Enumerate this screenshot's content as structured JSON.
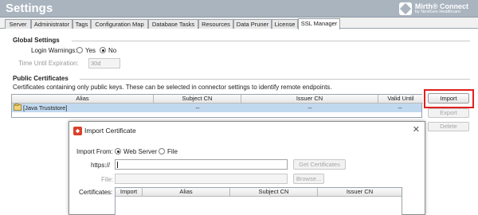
{
  "header": {
    "title": "Settings",
    "logo_name": "Mirth® Connect",
    "logo_sub": "by NextGen Healthcare"
  },
  "tabs": [
    {
      "label": "Server"
    },
    {
      "label": "Administrator"
    },
    {
      "label": "Tags"
    },
    {
      "label": "Configuration Map"
    },
    {
      "label": "Database Tasks"
    },
    {
      "label": "Resources"
    },
    {
      "label": "Data Pruner"
    },
    {
      "label": "License"
    },
    {
      "label": "SSL Manager",
      "active": true
    }
  ],
  "global_settings": {
    "title": "Global Settings",
    "login_warnings_label": "Login Warnings:",
    "yes_label": "Yes",
    "no_label": "No",
    "selected": "No",
    "time_until_expiration_label": "Time Until Expiration:",
    "time_until_expiration_value": "30d"
  },
  "public_certificates": {
    "title": "Public Certificates",
    "description": "Certificates containing only public keys. These can be selected in connector settings to identify remote endpoints.",
    "columns": [
      "Alias",
      "Subject CN",
      "Issuer CN",
      "Valid Until"
    ],
    "rows": [
      {
        "alias": "[Java Truststore]",
        "subject_cn": "--",
        "issuer_cn": "--",
        "valid_until": "--"
      }
    ],
    "import_button": "Import",
    "export_button": "Export",
    "delete_button": "Delete"
  },
  "dialog": {
    "title": "Import Certificate",
    "import_from_label": "Import From:",
    "web_server_label": "Web Server",
    "file_label": "File",
    "selected_source": "Web Server",
    "https_label": "https://",
    "https_value": "",
    "get_certificates_button": "Get Certificates",
    "file_field_label": "File:",
    "file_value": "",
    "browse_button": "Browse...",
    "certificates_label": "Certificates:",
    "columns": [
      "Import",
      "Alias",
      "Subject CN",
      "Issuer CN"
    ]
  },
  "colors": {
    "header_bg": "#a9b4bf",
    "selection": "#c1d9ef",
    "highlight": "#e0201f"
  }
}
